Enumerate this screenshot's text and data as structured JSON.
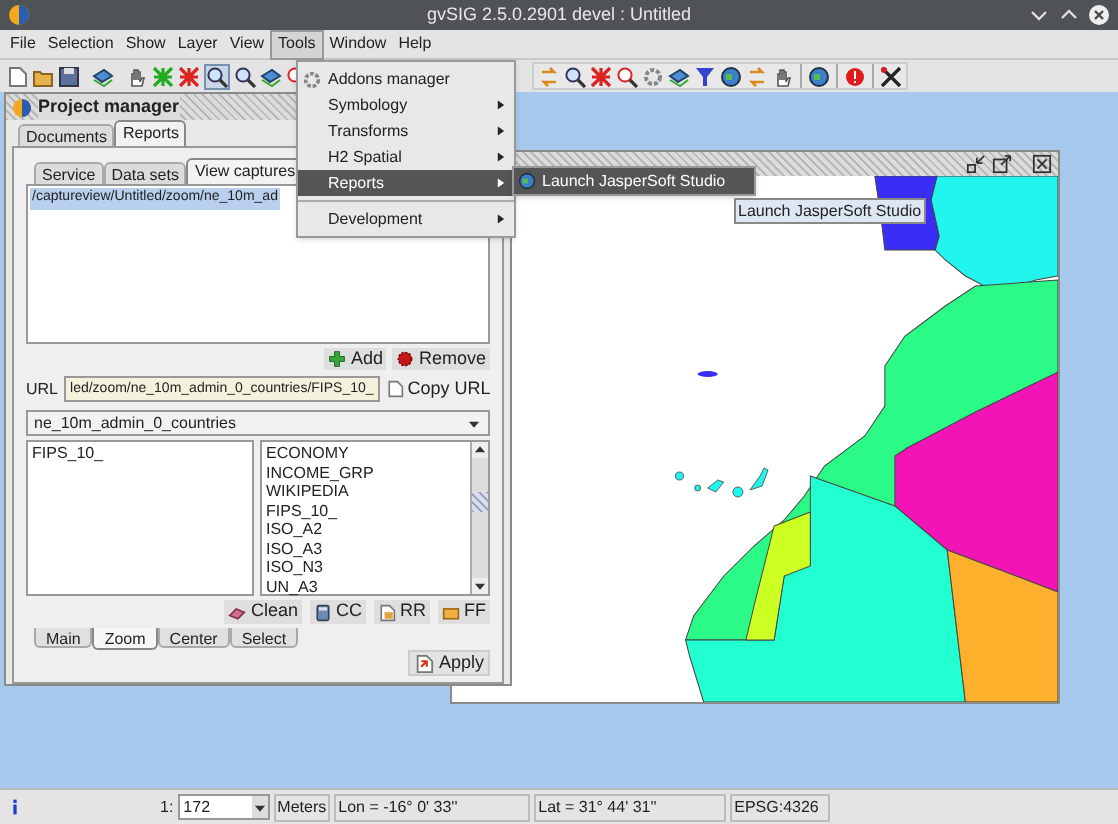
{
  "window": {
    "title": "gvSIG 2.5.0.2901 devel : Untitled"
  },
  "menu_bar": [
    {
      "label": "File",
      "selected": false
    },
    {
      "label": "Selection",
      "selected": false
    },
    {
      "label": "Show",
      "selected": false
    },
    {
      "label": "Layer",
      "selected": false
    },
    {
      "label": "View",
      "selected": false
    },
    {
      "label": "Tools",
      "selected": true
    },
    {
      "label": "Window",
      "selected": false
    },
    {
      "label": "Help",
      "selected": false
    }
  ],
  "tools_menu": [
    {
      "kind": "action",
      "label": "Addons manager",
      "selected": false
    },
    {
      "kind": "submenu",
      "label": "Symbology",
      "selected": false
    },
    {
      "kind": "submenu",
      "label": "Transforms",
      "selected": false
    },
    {
      "kind": "submenu",
      "label": "H2 Spatial",
      "selected": false
    },
    {
      "kind": "submenu",
      "label": "Reports",
      "selected": true
    },
    {
      "kind": "separator"
    },
    {
      "kind": "submenu",
      "label": "Development",
      "selected": false
    }
  ],
  "reports_submenu": [
    {
      "label": "Launch JasperSoft Studio",
      "selected": true
    }
  ],
  "tooltip": "Launch JasperSoft Studio",
  "project_manager": {
    "title": "Project manager",
    "tabs": [
      {
        "label": "Documents",
        "selected": false
      },
      {
        "label": "Reports",
        "selected": true
      }
    ],
    "inner_tabs": [
      {
        "label": "Service",
        "selected": false
      },
      {
        "label": "Data sets",
        "selected": false
      },
      {
        "label": "View captures",
        "selected": true
      }
    ],
    "captures": [
      {
        "path": "/captureview/Untitled/zoom/ne_10m_ad",
        "selected": true
      }
    ],
    "list_buttons": [
      "Add",
      "Remove"
    ],
    "url_label": "URL",
    "url": "led/zoom/ne_10m_admin_0_countries/FIPS_10_",
    "copy_button": "Copy URL",
    "layer": "ne_10m_admin_0_countries",
    "selected_fields": [
      "FIPS_10_"
    ],
    "fields": [
      "ECONOMY",
      "INCOME_GRP",
      "WIKIPEDIA",
      "FIPS_10_",
      "ISO_A2",
      "ISO_A3",
      "ISO_N3",
      "UN_A3"
    ],
    "field_buttons": [
      "Clean",
      "CC",
      "RR",
      "FF"
    ],
    "mode_tabs": [
      {
        "label": "Main",
        "selected": false
      },
      {
        "label": "Zoom",
        "selected": true
      },
      {
        "label": "Center",
        "selected": false
      },
      {
        "label": "Select",
        "selected": false
      }
    ],
    "apply_button": "Apply"
  },
  "status_bar": {
    "scale_prefix": "1:",
    "scale": "172",
    "units": "Meters",
    "lon": "Lon = -16° 0' 33''",
    "lat": "Lat = 31° 44' 31''",
    "crs": "EPSG:4326"
  }
}
